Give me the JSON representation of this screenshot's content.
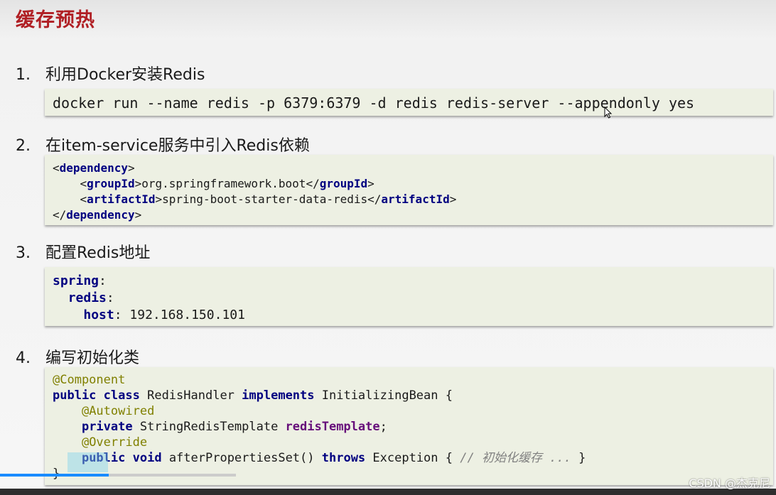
{
  "title": "缓存预热",
  "steps": [
    {
      "num": "1.",
      "label": "利用Docker安装Redis"
    },
    {
      "num": "2.",
      "label": "在item-service服务中引入Redis依赖"
    },
    {
      "num": "3.",
      "label": "配置Redis地址"
    },
    {
      "num": "4.",
      "label": "编写初始化类"
    }
  ],
  "code1": {
    "line": "docker run --name redis -p 6379:6379 -d redis redis-server --appendonly yes"
  },
  "code2": {
    "lt": "<",
    "gt": ">",
    "lt_slash": "</",
    "tag_dependency": "dependency",
    "tag_groupId": "groupId",
    "tag_artifactId": "artifactId",
    "groupId_value": "org.springframework.boot",
    "artifactId_value": "spring-boot-starter-data-redis"
  },
  "code3": {
    "key_spring": "spring",
    "key_redis": "redis",
    "key_host": "host",
    "colon": ":",
    "host_value": " 192.168.150.101"
  },
  "code4": {
    "ann_component": "@Component",
    "kw_public": "public",
    "kw_class": "class",
    "class_name": " RedisHandler ",
    "kw_implements": "implements",
    "iface": " InitializingBean {",
    "ann_autowired": "@Autowired",
    "kw_private": "private",
    "field_type": " StringRedisTemplate ",
    "field_name": "redisTemplate",
    "semicolon": ";",
    "ann_override": "@Override",
    "kw_void": "void",
    "method_sig": " afterPropertiesSet() ",
    "kw_throws": "throws",
    "exception": " Exception { ",
    "comment": "// 初始化缓存 ...",
    "method_end": " }",
    "close": "}"
  },
  "video": {
    "progress": 0.46
  },
  "watermark": "CSDN @杰克尼",
  "colors": {
    "title": "#b01f24",
    "code_bg": "#edf0e3",
    "keyword": "#000080",
    "annotation": "#808000",
    "field": "#660e7a",
    "progress": "#1a8cff"
  }
}
